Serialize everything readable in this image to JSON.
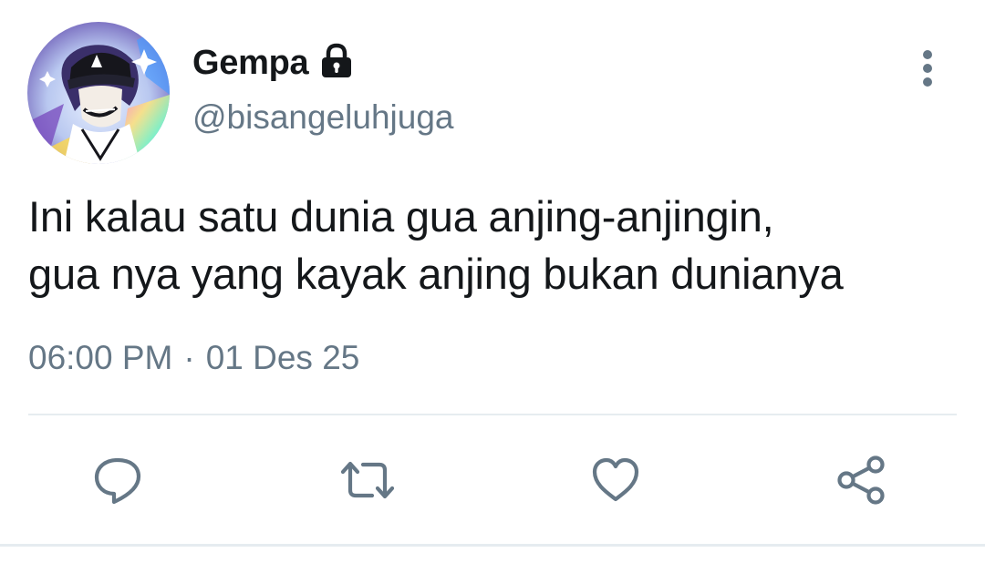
{
  "tweet": {
    "author": {
      "display_name": "Gempa",
      "handle": "@bisangeluhjuga",
      "protected": true,
      "avatar": "anime-character-avatar"
    },
    "text_lines": [
      "Ini kalau satu dunia gua anjing-anjingin,",
      "gua nya yang kayak anjing bukan dunianya"
    ],
    "time": "06:00 PM",
    "separator": "·",
    "date": "01 Des 25",
    "actions": [
      {
        "name": "reply",
        "icon": "speech-bubble-icon"
      },
      {
        "name": "retweet",
        "icon": "retweet-arrows-icon"
      },
      {
        "name": "like",
        "icon": "heart-icon"
      },
      {
        "name": "share",
        "icon": "share-nodes-icon"
      }
    ],
    "colors": {
      "text_primary": "#14171a",
      "text_secondary": "#657786",
      "icon_gray": "#657786",
      "divider": "#e6ecf0"
    }
  }
}
